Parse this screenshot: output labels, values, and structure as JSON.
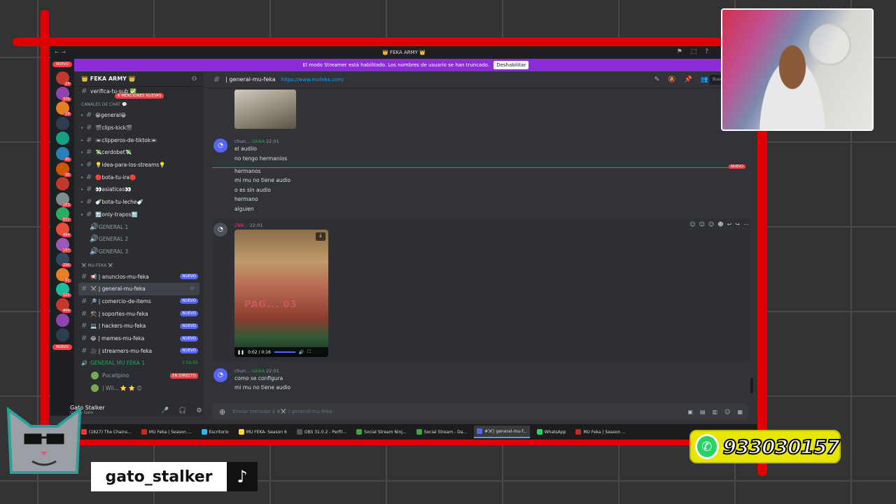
{
  "window": {
    "title": "👑 FEKA ARMY 👑",
    "streamer_banner": "El modo Streamer está habilitado. Los nombres de usuario se han truncado.",
    "streamer_button": "Deshabilitar"
  },
  "servers": {
    "nuevo_top": "NUEVO",
    "nuevo_bottom": "NUEVO",
    "badges": [
      "24",
      "376",
      "19",
      "",
      "",
      "45",
      "50",
      "",
      "163",
      "631",
      "494",
      "197",
      "296",
      "61",
      "516",
      "444",
      "",
      ""
    ]
  },
  "sidebar": {
    "server_name": "👑 FEKA ARMY 👑",
    "mentions_pill": "6 MENCIONES NUEVAS",
    "verify_channel": "verifica-tu-sub ✅",
    "category_chat": "CANALES DE CHAT 💬",
    "channels": [
      {
        "label": "😀general😀",
        "type": "text"
      },
      {
        "label": "🎬clips-kick🎬",
        "type": "text"
      },
      {
        "label": "📼clipperos-de-tiktok📼",
        "type": "text"
      },
      {
        "label": "💸cerdobet💸",
        "type": "text"
      },
      {
        "label": "💡idea-para-los-streams💡",
        "type": "text"
      },
      {
        "label": "🔴bota-tu-ira🔴",
        "type": "text"
      },
      {
        "label": "👀asiaticas👀",
        "type": "text"
      },
      {
        "label": "🍼bota-tu-leche🍼",
        "type": "text"
      },
      {
        "label": "🔚only-trapos🔚",
        "type": "text"
      },
      {
        "label": "GENERAL 1",
        "type": "voice"
      },
      {
        "label": "GENERAL 2",
        "type": "voice"
      },
      {
        "label": "GENERAL 3",
        "type": "voice"
      }
    ],
    "category_mu": "⚔️ MU-FEKA ⚔️",
    "mu_channels": [
      {
        "label": "📢 | anuncios-mu-feka",
        "badge": "NUEVO"
      },
      {
        "label": "⚔️ | general-mu-feka",
        "badge": ""
      },
      {
        "label": "🔎 | comercio-de-items",
        "badge": "NUEVO"
      },
      {
        "label": "⚒️ | soportes-mu-feka",
        "badge": "NUEVO"
      },
      {
        "label": "💻 | hackers-mu-feka",
        "badge": "NUEVO"
      },
      {
        "label": "😂 | memes-mu-feka",
        "badge": "NUEVO"
      },
      {
        "label": "🎥 | streamers-mu-feka",
        "badge": "NUEVO"
      }
    ],
    "voice_live": {
      "label": "GENERAL MU FEKA 1",
      "time": "1:56:55"
    },
    "voice_users": [
      {
        "name": "Pucallpino",
        "badge": "EN DIRECTO"
      },
      {
        "name": "| Wil... ⭐ ⭐ 😊",
        "badge": ""
      }
    ]
  },
  "user_panel": {
    "name": "Gato Stalker",
    "subtitle": "Gato y Gato"
  },
  "channel_header": {
    "name": "| general-mu-feka",
    "url": "https://www.mufeka.com/",
    "search_placeholder": "Buscar 👑 FEKA ARMY"
  },
  "messages": [
    {
      "author": "chun...",
      "tag": "GAAA",
      "time": "22:01",
      "lines": [
        "el audiio",
        "no tengo hermanios"
      ]
    },
    {
      "author": "",
      "tag": "",
      "time": "",
      "lines": [
        "hermanos",
        "mi mu no tiene audio",
        "o es sin audio",
        "hermano",
        "alguien"
      ]
    },
    {
      "author": "ZBB...",
      "tag": "",
      "time": "22:01",
      "video_time": "0:02 / 0:16",
      "video_overlay": "PAG... 03"
    },
    {
      "author": "chun...",
      "tag": "GAAA",
      "time": "22:01",
      "lines": [
        "como se configura",
        "mi mu no tiene audio"
      ]
    }
  ],
  "new_divider": "NUEVO",
  "input": {
    "placeholder": "Enviar mensaje a #⚔️ | general-mu-feka"
  },
  "taskbar": [
    {
      "label": "(1827) The Chains...",
      "color": "#e53935",
      "active": false
    },
    {
      "label": "MU Feka | Season ...",
      "color": "#c62828",
      "active": false
    },
    {
      "label": "Escritorio",
      "color": "#29b6f6",
      "active": false
    },
    {
      "label": "MU FEKA- Season 6",
      "color": "#fdd835",
      "active": false
    },
    {
      "label": "OBS 31.0.2 - Perfil...",
      "color": "#555",
      "active": false
    },
    {
      "label": "Social Stream Ninj...",
      "color": "#43a047",
      "active": false
    },
    {
      "label": "Social Stream - Da...",
      "color": "#43a047",
      "active": false
    },
    {
      "label": "#⚔️| general-mu-f...",
      "color": "#5865f2",
      "active": true
    },
    {
      "label": "WhatsApp",
      "color": "#25d366",
      "active": false
    },
    {
      "label": "MU Feka | Season ...",
      "color": "#c62828",
      "active": false
    }
  ],
  "overlay": {
    "whatsapp_number": "933030157",
    "handle": "gato_stalker"
  }
}
